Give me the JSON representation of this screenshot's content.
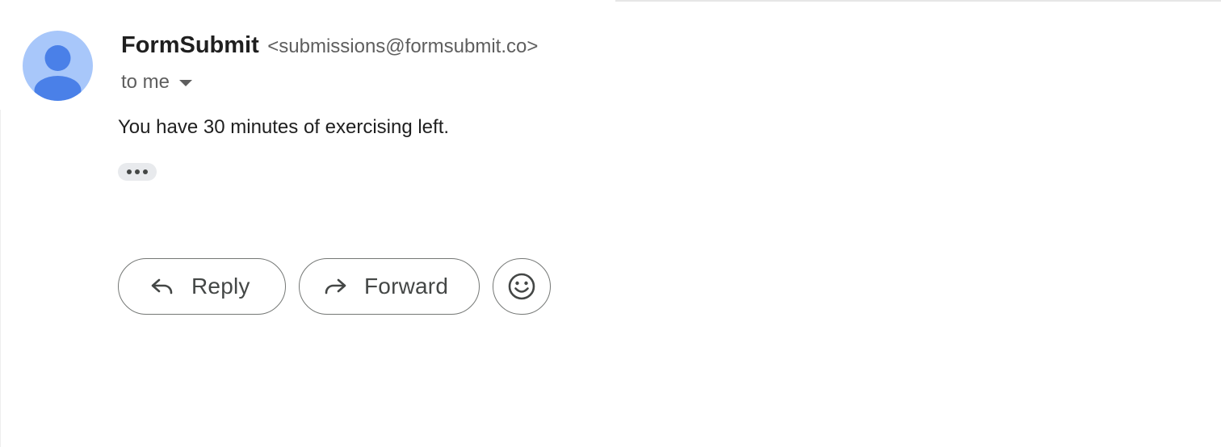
{
  "message": {
    "sender": {
      "name": "FormSubmit",
      "email": "<submissions@formsubmit.co>",
      "avatar_icon": "person-avatar-icon"
    },
    "recipient": {
      "label": "to me",
      "dropdown_icon": "caret-down-icon"
    },
    "body": "You have 30 minutes of exercising left.",
    "trimmed_content_icon": "more-horizontal-icon"
  },
  "actions": {
    "reply_label": "Reply",
    "reply_icon": "reply-arrow-icon",
    "forward_label": "Forward",
    "forward_icon": "forward-arrow-icon",
    "emoji_icon": "emoji-smiley-icon"
  },
  "colors": {
    "avatar_background": "#a8c7fa",
    "avatar_figure": "#4a80e8",
    "button_border": "#747775",
    "text_primary": "#1f1f1f",
    "text_secondary": "#5e5e5e"
  }
}
